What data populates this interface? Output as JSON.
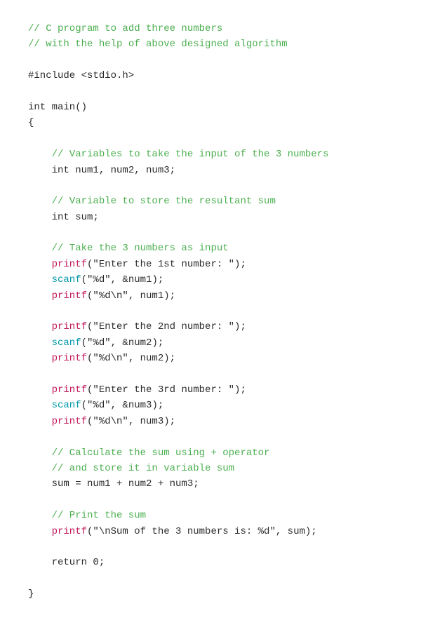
{
  "code": {
    "lines": [
      {
        "id": "line1",
        "parts": [
          {
            "text": "// C program to add three numbers",
            "color": "comment"
          }
        ]
      },
      {
        "id": "line2",
        "parts": [
          {
            "text": "// with the help of above designed algorithm",
            "color": "comment"
          }
        ]
      },
      {
        "id": "blank1",
        "parts": []
      },
      {
        "id": "line3",
        "parts": [
          {
            "text": "#include <stdio.h>",
            "color": "include"
          }
        ]
      },
      {
        "id": "blank2",
        "parts": []
      },
      {
        "id": "line4",
        "parts": [
          {
            "text": "int main()",
            "color": "plain"
          }
        ]
      },
      {
        "id": "line5",
        "parts": [
          {
            "text": "{",
            "color": "brace"
          }
        ]
      },
      {
        "id": "blank3",
        "parts": []
      },
      {
        "id": "line6",
        "parts": [
          {
            "text": "    // Variables to take the input of the 3 numbers",
            "color": "comment"
          }
        ]
      },
      {
        "id": "line7",
        "parts": [
          {
            "text": "    int num1, num2, num3;",
            "color": "plain"
          }
        ]
      },
      {
        "id": "blank4",
        "parts": []
      },
      {
        "id": "line8",
        "parts": [
          {
            "text": "    // Variable to store the resultant sum",
            "color": "comment"
          }
        ]
      },
      {
        "id": "line9",
        "parts": [
          {
            "text": "    int sum;",
            "color": "plain"
          }
        ]
      },
      {
        "id": "blank5",
        "parts": []
      },
      {
        "id": "line10",
        "parts": [
          {
            "text": "    // Take the 3 numbers as input",
            "color": "comment"
          }
        ]
      },
      {
        "id": "line11",
        "parts": [
          {
            "text": "    printf",
            "color": "magenta"
          },
          {
            "text": "(\"Enter the 1st number: \");",
            "color": "plain"
          }
        ]
      },
      {
        "id": "line12",
        "parts": [
          {
            "text": "    scanf",
            "color": "cyan"
          },
          {
            "text": "(\"%d\", &num1);",
            "color": "plain"
          }
        ]
      },
      {
        "id": "line13",
        "parts": [
          {
            "text": "    printf",
            "color": "magenta"
          },
          {
            "text": "(\"%d\\n\", num1);",
            "color": "plain"
          }
        ]
      },
      {
        "id": "blank6",
        "parts": []
      },
      {
        "id": "line14",
        "parts": [
          {
            "text": "    printf",
            "color": "magenta"
          },
          {
            "text": "(\"Enter the 2nd number: \");",
            "color": "plain"
          }
        ]
      },
      {
        "id": "line15",
        "parts": [
          {
            "text": "    scanf",
            "color": "cyan"
          },
          {
            "text": "(\"%d\", &num2);",
            "color": "plain"
          }
        ]
      },
      {
        "id": "line16",
        "parts": [
          {
            "text": "    printf",
            "color": "magenta"
          },
          {
            "text": "(\"%d\\n\", num2);",
            "color": "plain"
          }
        ]
      },
      {
        "id": "blank7",
        "parts": []
      },
      {
        "id": "line17",
        "parts": [
          {
            "text": "    printf",
            "color": "magenta"
          },
          {
            "text": "(\"Enter the 3rd number: \");",
            "color": "plain"
          }
        ]
      },
      {
        "id": "line18",
        "parts": [
          {
            "text": "    scanf",
            "color": "cyan"
          },
          {
            "text": "(\"%d\", &num3);",
            "color": "plain"
          }
        ]
      },
      {
        "id": "line19",
        "parts": [
          {
            "text": "    printf",
            "color": "magenta"
          },
          {
            "text": "(\"%d\\n\", num3);",
            "color": "plain"
          }
        ]
      },
      {
        "id": "blank8",
        "parts": []
      },
      {
        "id": "line20",
        "parts": [
          {
            "text": "    // Calculate the sum using + operator",
            "color": "comment"
          }
        ]
      },
      {
        "id": "line21",
        "parts": [
          {
            "text": "    // and store it in variable sum",
            "color": "comment"
          }
        ]
      },
      {
        "id": "line22",
        "parts": [
          {
            "text": "    sum = num1 + num2 + num3;",
            "color": "plain"
          }
        ]
      },
      {
        "id": "blank9",
        "parts": []
      },
      {
        "id": "line23",
        "parts": [
          {
            "text": "    // Print the sum",
            "color": "comment"
          }
        ]
      },
      {
        "id": "line24",
        "parts": [
          {
            "text": "    printf",
            "color": "magenta"
          },
          {
            "text": "(\"\\nSum of the 3 numbers is: %d\", sum);",
            "color": "plain"
          }
        ]
      },
      {
        "id": "blank10",
        "parts": []
      },
      {
        "id": "line25",
        "parts": [
          {
            "text": "    return 0;",
            "color": "plain"
          }
        ]
      },
      {
        "id": "blank11",
        "parts": []
      },
      {
        "id": "line26",
        "parts": [
          {
            "text": "}",
            "color": "brace"
          }
        ]
      }
    ]
  }
}
